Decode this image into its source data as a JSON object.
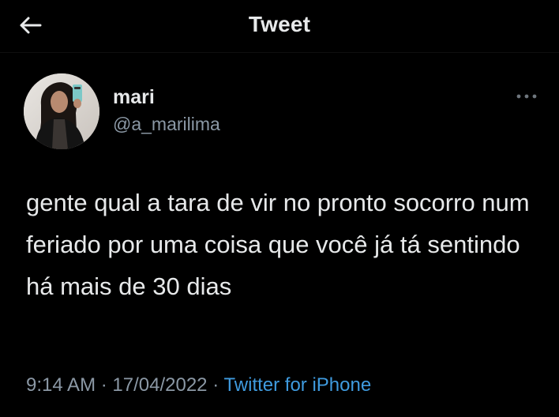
{
  "header": {
    "title": "Tweet",
    "back_icon": "arrow-left-icon"
  },
  "author": {
    "name": "mari",
    "handle": "@a_marilima",
    "avatar_icon": "profile-photo"
  },
  "more_icon": "more-horizontal-icon",
  "tweet": {
    "text": "gente qual a tara de vir no pronto socorro num feriado por uma coisa que você já tá sentindo há mais de 30 dias"
  },
  "meta": {
    "time": "9:14 AM",
    "separator": "·",
    "date": "17/04/2022",
    "source": "Twitter for iPhone"
  },
  "colors": {
    "background": "#000000",
    "text": "#e7e9ea",
    "secondary": "#8b98a5",
    "link": "#3f9bdf"
  }
}
